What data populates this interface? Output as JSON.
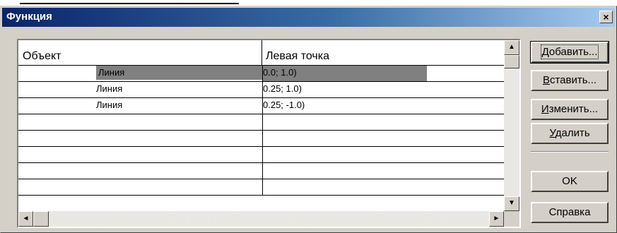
{
  "dialog": {
    "title": "Функция",
    "close_label": "×"
  },
  "table": {
    "columns": [
      "Объект",
      "Левая точка"
    ],
    "rows": [
      {
        "object": "Линия",
        "left_point": "0.0; 1.0)",
        "selected": true
      },
      {
        "object": "Линия",
        "left_point": "0.25; 1.0)",
        "selected": false
      },
      {
        "object": "Линия",
        "left_point": "0.25; -1.0)",
        "selected": false
      },
      {
        "object": "",
        "left_point": "",
        "selected": false
      },
      {
        "object": "",
        "left_point": "",
        "selected": false
      },
      {
        "object": "",
        "left_point": "",
        "selected": false
      },
      {
        "object": "",
        "left_point": "",
        "selected": false
      },
      {
        "object": "",
        "left_point": "",
        "selected": false
      }
    ]
  },
  "buttons": {
    "add": {
      "mnemonic": "Д",
      "rest": "обавить..."
    },
    "insert": {
      "mnemonic": "В",
      "rest": "ставить..."
    },
    "edit": {
      "mnemonic": "И",
      "rest": "зменить..."
    },
    "delete": {
      "mnemonic": "У",
      "rest": "далить"
    },
    "ok": "OK",
    "help": "Справка"
  },
  "icons": {
    "scroll_up": "▲",
    "scroll_down": "▼",
    "scroll_left": "◄",
    "scroll_right": "►"
  }
}
